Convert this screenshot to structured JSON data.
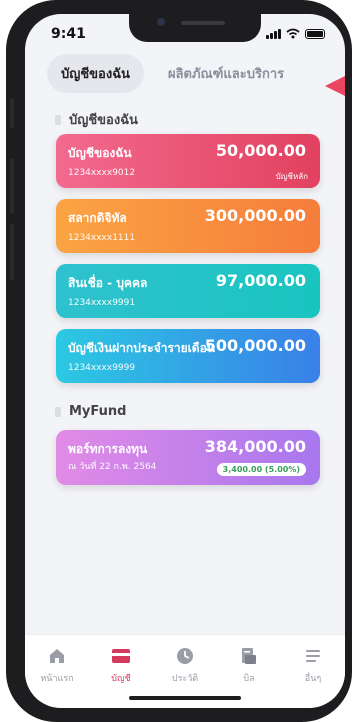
{
  "status_bar": {
    "time": "9:41"
  },
  "tabs": [
    {
      "label": "บัญชีของฉัน",
      "active": true
    },
    {
      "label": "ผลิตภัณฑ์และบริการ",
      "active": false
    }
  ],
  "accounts_section": {
    "title": "บัญชีของฉัน",
    "cards": [
      {
        "name": "บัญชีของฉัน",
        "account": "1234xxxx9012",
        "amount": "50,000.00",
        "tag": "บัญชีหลัก",
        "colors": [
          "#f36a8f",
          "#e2415f"
        ]
      },
      {
        "name": "สลากดิจิทัล",
        "account": "1234xxxx1111",
        "amount": "300,000.00",
        "tag": "",
        "colors": [
          "#fba443",
          "#f57d3b"
        ]
      },
      {
        "name": "สินเชื่อ - บุคคล",
        "account": "1234xxxx9991",
        "amount": "97,000.00",
        "tag": "",
        "colors": [
          "#2fc1cf",
          "#19c5c0"
        ]
      },
      {
        "name": "บัญชีเงินฝากประจำรายเดือน",
        "account": "1234xxxx9999",
        "amount": "500,000.00",
        "tag": "",
        "colors": [
          "#2bc9e2",
          "#3a80e8"
        ]
      }
    ]
  },
  "fund_section": {
    "title": "MyFund",
    "card": {
      "name": "พอร์ทการลงทุน",
      "date": "ณ วันที่ 22 ก.พ. 2564",
      "amount": "384,000.00",
      "gain": "3,400.00 (5.00%)",
      "colors": [
        "#e18be6",
        "#a877ee"
      ]
    }
  },
  "bottom_nav": [
    {
      "label": "หน้าแรก",
      "icon": "home-icon",
      "active": false
    },
    {
      "label": "บัญชี",
      "icon": "card-icon",
      "active": true
    },
    {
      "label": "ประวัติ",
      "icon": "clock-icon",
      "active": false
    },
    {
      "label": "บิล",
      "icon": "bill-icon",
      "active": false
    },
    {
      "label": "อื่นๆ",
      "icon": "menu-icon",
      "active": false
    }
  ],
  "colors": {
    "accent": "#d43a5e",
    "inactive_icon": "#9a9da6",
    "deco_triangle": "#ea4561"
  }
}
